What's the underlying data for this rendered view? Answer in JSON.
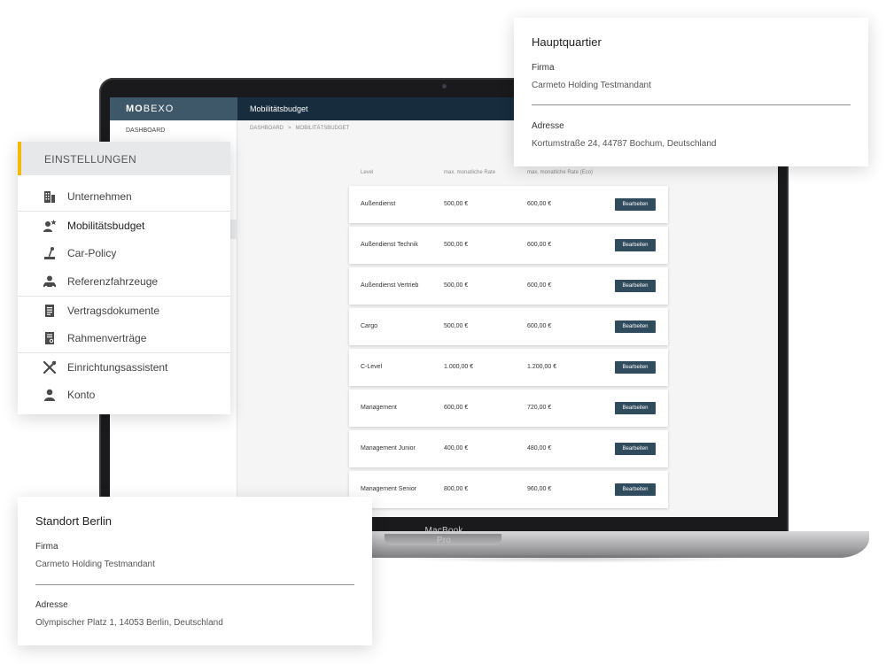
{
  "laptop": {
    "brand": "MacBook Pro"
  },
  "app": {
    "logo_bold": "MO",
    "logo_light": "BEXO",
    "page_title": "Mobilitätsbudget",
    "sidebar_first_item": "DASHBOARD",
    "breadcrumb": [
      "DASHBOARD",
      ">",
      "MOBILITÄTSBUDGET"
    ],
    "columns": [
      "Level",
      "max. monatliche Rate",
      "max. monatliche Rate (Eco)"
    ],
    "edit_label": "Bearbeiten",
    "rows": [
      {
        "level": "Außendienst",
        "rate": "500,00 €",
        "eco": "600,00 €"
      },
      {
        "level": "Außendienst Technik",
        "rate": "500,00 €",
        "eco": "600,00 €"
      },
      {
        "level": "Außendienst Vertrieb",
        "rate": "500,00 €",
        "eco": "600,00 €"
      },
      {
        "level": "Cargo",
        "rate": "500,00 €",
        "eco": "600,00 €"
      },
      {
        "level": "C-Level",
        "rate": "1.000,00 €",
        "eco": "1.200,00 €"
      },
      {
        "level": "Management",
        "rate": "600,00 €",
        "eco": "720,00 €"
      },
      {
        "level": "Management Junior",
        "rate": "400,00 €",
        "eco": "480,00 €"
      },
      {
        "level": "Management Senior",
        "rate": "800,00 €",
        "eco": "960,00 €"
      }
    ]
  },
  "settings": {
    "header": "EINSTELLUNGEN",
    "accent_color": "#f5b900",
    "items": [
      {
        "label": "Unternehmen",
        "icon": "building-icon"
      },
      {
        "label": "Mobilitätsbudget",
        "icon": "user-star-icon"
      },
      {
        "label": "Car-Policy",
        "icon": "gear-shift-icon"
      },
      {
        "label": "Referenzfahrzeuge",
        "icon": "user-car-icon"
      },
      {
        "label": "Vertragsdokumente",
        "icon": "document-icon"
      },
      {
        "label": "Rahmenverträge",
        "icon": "contract-icon"
      },
      {
        "label": "Einrichtungsassistent",
        "icon": "tools-icon"
      },
      {
        "label": "Konto",
        "icon": "user-icon"
      }
    ]
  },
  "hq": {
    "title": "Hauptquartier",
    "firma_label": "Firma",
    "firma_value": "Carmeto Holding Testmandant",
    "adresse_label": "Adresse",
    "adresse_value": "Kortumstraße 24, 44787 Bochum, Deutschland"
  },
  "berlin": {
    "title": "Standort Berlin",
    "firma_label": "Firma",
    "firma_value": "Carmeto Holding Testmandant",
    "adresse_label": "Adresse",
    "adresse_value": "Olympischer Platz 1, 14053 Berlin, Deutschland"
  }
}
